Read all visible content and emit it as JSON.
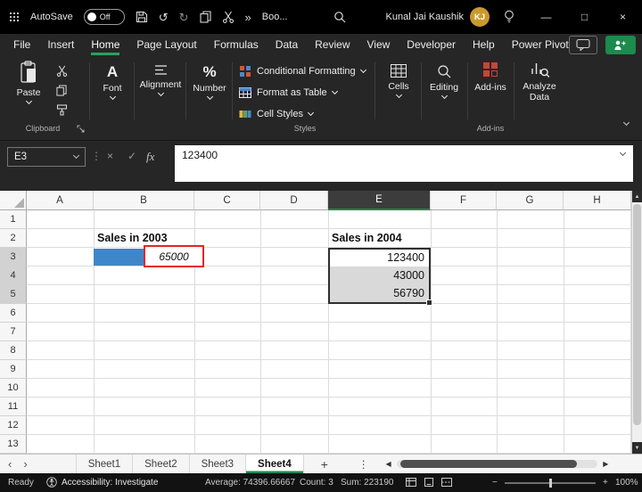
{
  "colors": {
    "accent_green": "#21a366",
    "selection_blue": "#3f86c9",
    "annotation_red": "#e4252b",
    "addins_red": "#c74634",
    "avatar_gold": "#c9992e"
  },
  "icons": {
    "undo": "↺",
    "redo": "↻",
    "overflow": "»",
    "menu_dots": "⋮",
    "cancel": "×",
    "confirm": "✓",
    "minimize": "—",
    "maximize": "□",
    "close": "×",
    "nav_left": "‹",
    "nav_right": "›",
    "add_sheet": "+",
    "scroll_left": "◀",
    "scroll_right": "▶",
    "scroll_up": "▲",
    "scroll_down": "▼",
    "zoom_out": "−",
    "zoom_in": "+",
    "font_glyph": "A",
    "number_glyph": "%"
  },
  "title_bar": {
    "autosave_label": "AutoSave",
    "autosave_state": "Off",
    "workbook_name": "Boo...",
    "user_name": "Kunal Jai Kaushik",
    "user_initials": "KJ"
  },
  "menu": {
    "items": [
      "File",
      "Insert",
      "Home",
      "Page Layout",
      "Formulas",
      "Data",
      "Review",
      "View",
      "Developer",
      "Help",
      "Power Pivot"
    ],
    "active": "Home"
  },
  "ribbon": {
    "paste_label": "Paste",
    "clipboard_group": "Clipboard",
    "font_label": "Font",
    "alignment_label": "Alignment",
    "number_label": "Number",
    "conditional_formatting": "Conditional Formatting",
    "format_as_table": "Format as Table",
    "cell_styles": "Cell Styles",
    "styles_group": "Styles",
    "cells_label": "Cells",
    "editing_label": "Editing",
    "addins_label": "Add-ins",
    "addins_group": "Add-ins",
    "analyze_label": "Analyze Data"
  },
  "formula_bar": {
    "name_box": "E3",
    "fx": "fx",
    "formula": "123400"
  },
  "grid": {
    "columns": [
      "A",
      "B",
      "C",
      "D",
      "E",
      "F",
      "G",
      "H"
    ],
    "rows": [
      "1",
      "2",
      "3",
      "4",
      "5",
      "6",
      "7",
      "8",
      "9",
      "10",
      "11",
      "12",
      "13"
    ],
    "active_cell": "E3",
    "cells": {
      "b2_label": "Sales in 2003",
      "b3_value": "65000",
      "e2_label": "Sales in 2004",
      "e3_value": "123400",
      "e4_value": "43000",
      "e5_value": "56790"
    }
  },
  "sheet_tabs": {
    "tabs": [
      "Sheet1",
      "Sheet2",
      "Sheet3",
      "Sheet4"
    ],
    "active": "Sheet4"
  },
  "status_bar": {
    "ready": "Ready",
    "accessibility": "Accessibility: Investigate",
    "average": "Average: 74396.66667",
    "count": "Count: 3",
    "sum": "Sum: 223190",
    "zoom": "100%"
  }
}
